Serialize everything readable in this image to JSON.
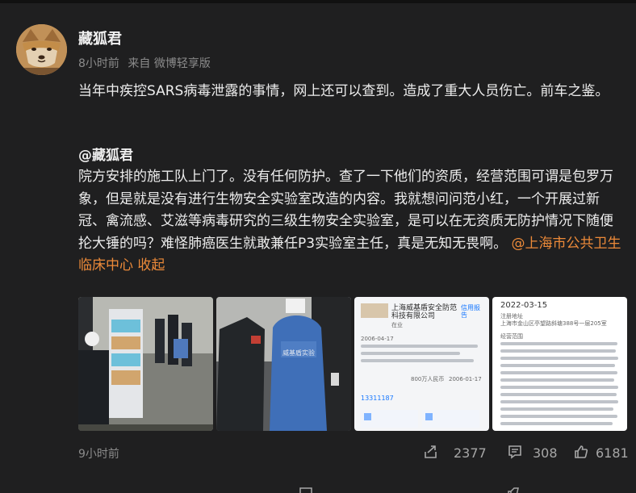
{
  "post": {
    "author": "藏狐君",
    "time": "8小时前",
    "source": "来自 微博轻享版",
    "text": "当年中疾控SARS病毒泄露的事情，网上还可以查到。造成了重大人员伤亡。前车之鉴。"
  },
  "quote": {
    "author": "@藏狐君",
    "text": "院方安排的施工队上门了。没有任何防护。查了一下他们的资质，经营范围可谓是包罗万象，但是就是没有进行生物安全实验室改造的内容。我就想问问范小红，一个开展过新冠、禽流感、艾滋等病毒研究的三级生物安全实验室，是可以在无资质无防护情况下随便抡大锤的吗？难怪肺癌医生就敢兼任P3实验室主任，真是无知无畏啊。",
    "mention": "@上海市公共卫生临床中心",
    "collapse": "收起"
  },
  "images": {
    "photo_2": {
      "vest_text": "威基盾实验"
    },
    "photo_3": {
      "company": "上海威基盾安全防范科技有限公司",
      "badge": "在业",
      "tag": "信用报告",
      "date": "2006-04-17",
      "phone": "13311187",
      "capital": "800万人民币",
      "register_date": "2006-01-17"
    },
    "photo_4": {
      "date": "2022-03-15",
      "address_label": "注册地址",
      "address": "上海市金山区亭望路斜塘388号一层205室",
      "scope_label": "经营范围"
    }
  },
  "footer": {
    "time": "9小时前",
    "share_count": "2377",
    "comment_count": "308",
    "like_count": "6181"
  },
  "colors": {
    "background": "#1f1f20",
    "text": "#ededed",
    "meta": "#8b8b8b",
    "link": "#ec8a39"
  },
  "icons": {
    "share": "share-icon",
    "comment": "comment-icon",
    "like": "like-icon"
  }
}
